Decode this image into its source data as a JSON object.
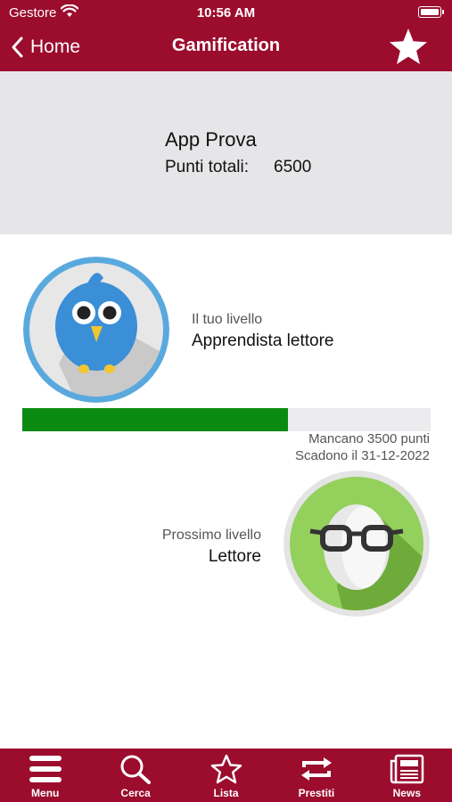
{
  "status_bar": {
    "carrier": "Gestore",
    "time": "10:56 AM"
  },
  "nav": {
    "back_label": "Home",
    "title": "Gamification",
    "favorite_icon": "star-icon"
  },
  "summary": {
    "app_name": "App Prova",
    "points_label": "Punti totali:",
    "points_value": "6500"
  },
  "current_level": {
    "caption": "Il tuo livello",
    "name": "Apprendista lettore",
    "avatar_icon": "bird-avatar-icon"
  },
  "progress": {
    "fraction": 0.65,
    "color": "#0b8a12",
    "remaining_text": "Mancano 3500 punti",
    "expiry_text": "Scadono il 31-12-2022"
  },
  "next_level": {
    "caption": "Prossimo livello",
    "name": "Lettore",
    "avatar_icon": "glasses-avatar-icon"
  },
  "tabs": [
    {
      "label": "Menu",
      "icon": "menu-icon"
    },
    {
      "label": "Cerca",
      "icon": "search-icon"
    },
    {
      "label": "Lista",
      "icon": "star-outline-icon"
    },
    {
      "label": "Prestiti",
      "icon": "loan-icon"
    },
    {
      "label": "News",
      "icon": "newspaper-icon"
    }
  ],
  "colors": {
    "brand": "#9b0c2d",
    "summary_bg": "#e6e6e8",
    "progress_track": "#ececee"
  }
}
